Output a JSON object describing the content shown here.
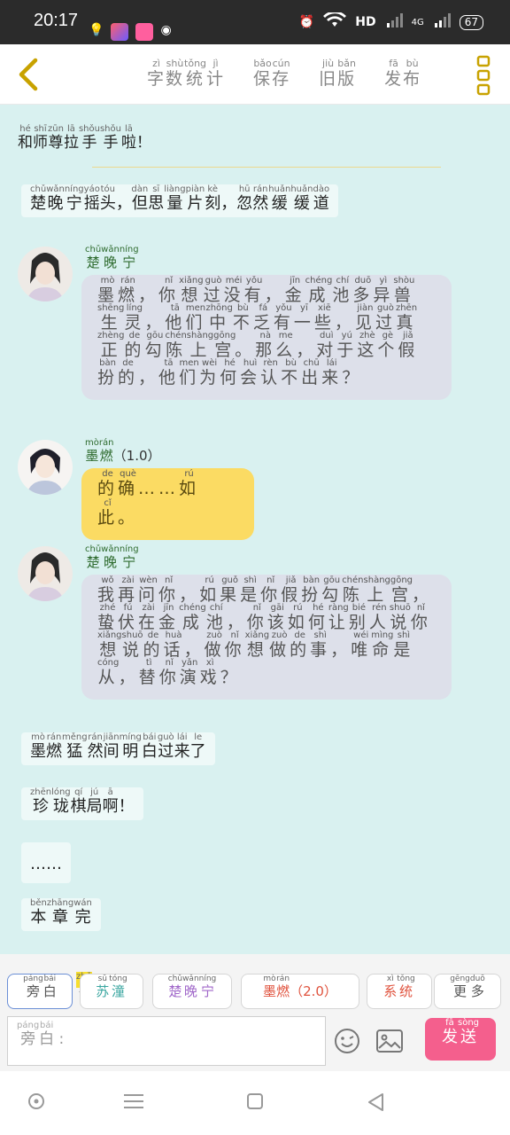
{
  "status": {
    "time": "20:17",
    "network": "HD",
    "signal_label": "4G",
    "battery": "67"
  },
  "header": {
    "actions": [
      {
        "text": "字数统计",
        "pinyin": [
          "zì",
          "shù",
          "tǒng",
          "jì"
        ]
      },
      {
        "text": "保存",
        "pinyin": [
          "bǎo",
          "cún"
        ]
      },
      {
        "text": "旧版",
        "pinyin": [
          "jiù",
          "bǎn"
        ]
      },
      {
        "text": "发布",
        "pinyin": [
          "fā",
          "bù"
        ]
      }
    ]
  },
  "messages": [
    {
      "kind": "narration",
      "text": "和师尊拉手手啦！",
      "pinyin": [
        "hé",
        "shī",
        "zūn",
        "lā",
        "shǒu",
        "shǒu",
        "lā",
        ""
      ]
    },
    {
      "kind": "narration",
      "text": "楚晚宁摇头，但思量片刻，忽然缓缓道",
      "pinyin": [
        "chǔ",
        "wǎn",
        "níng",
        "yáo",
        "tóu",
        "",
        "dàn",
        "sī",
        "liàng",
        "piàn",
        "kè",
        "",
        "hū",
        "rán",
        "huǎn",
        "huǎn",
        "dào"
      ]
    },
    {
      "kind": "bubble",
      "speaker": {
        "text": "楚晚宁",
        "pinyin": [
          "chǔ",
          "wǎn",
          "níng"
        ]
      },
      "text": "墨燃，你想过没有，金成池多异兽生灵，他们中不乏有一些，见过真正的勾陈上宫。那么，对于这个假扮的，他们为何会认不出来？",
      "pinyin": [
        "mò",
        "rán",
        "",
        "nǐ",
        "xiǎng",
        "guò",
        "méi",
        "yǒu",
        "",
        "jīn",
        "chéng",
        "chí",
        "duō",
        "yì",
        "shòu",
        "shēng",
        "líng",
        "",
        "tā",
        "men",
        "zhōng",
        "bù",
        "fá",
        "yǒu",
        "yī",
        "xiē",
        "",
        "jiàn",
        "guò",
        "zhēn",
        "zhèng",
        "de",
        "gōu",
        "chén",
        "shàng",
        "gōng",
        "",
        "nà",
        "me",
        "",
        "duì",
        "yú",
        "zhè",
        "gè",
        "jiǎ",
        "bàn",
        "de",
        "",
        "tā",
        "men",
        "wèi",
        "hé",
        "huì",
        "rèn",
        "bù",
        "chū",
        "lái",
        ""
      ]
    },
    {
      "kind": "bubble",
      "speaker": {
        "text": "墨燃",
        "pinyin": [
          "mò",
          "rán"
        ],
        "suffix": "（1.0）"
      },
      "text": "的确……如此。",
      "pinyin": [
        "de",
        "què",
        "",
        "",
        "rú",
        "cǐ",
        ""
      ]
    },
    {
      "kind": "bubble",
      "speaker": {
        "text": "楚晚宁",
        "pinyin": [
          "chǔ",
          "wǎn",
          "níng"
        ]
      },
      "text": "我再问你，如果是你假扮勾陈上宫，蛰伏在金成池，你该如何让别人说你想说的话，做你想做的事，唯命是从，替你演戏？",
      "pinyin": [
        "wǒ",
        "zài",
        "wèn",
        "nǐ",
        "",
        "rú",
        "guǒ",
        "shì",
        "nǐ",
        "jiǎ",
        "bàn",
        "gōu",
        "chén",
        "shàng",
        "gōng",
        "",
        "zhé",
        "fú",
        "zài",
        "jīn",
        "chéng",
        "chí",
        "",
        "nǐ",
        "gāi",
        "rú",
        "hé",
        "ràng",
        "bié",
        "rén",
        "shuō",
        "nǐ",
        "xiǎng",
        "shuō",
        "de",
        "huà",
        "",
        "zuò",
        "nǐ",
        "xiǎng",
        "zuò",
        "de",
        "shì",
        "",
        "wéi",
        "mìng",
        "shì",
        "cóng",
        "",
        "tì",
        "nǐ",
        "yǎn",
        "xì",
        ""
      ]
    },
    {
      "kind": "narration",
      "text": "墨燃猛然间明白过来了",
      "pinyin": [
        "mò",
        "rán",
        "měng",
        "rán",
        "jiān",
        "míng",
        "bái",
        "guò",
        "lái",
        "le"
      ]
    },
    {
      "kind": "narration",
      "text": "珍珑棋局啊！",
      "pinyin": [
        "zhēn",
        "lóng",
        "qí",
        "jú",
        "ā",
        ""
      ]
    },
    {
      "kind": "narration",
      "text": "……",
      "pinyin": [
        ""
      ]
    },
    {
      "kind": "narration",
      "text": "本章完",
      "pinyin": [
        "běn",
        "zhāng",
        "wán"
      ]
    }
  ],
  "roles": [
    {
      "text": "旁白",
      "pinyin": [
        "páng",
        "bái"
      ],
      "color": "#555555",
      "active": true
    },
    {
      "text": "苏潼",
      "pinyin": [
        "sū",
        "tóng"
      ],
      "color": "#3aa6a0",
      "badge": {
        "text": "主",
        "pinyin": "zhǔ"
      }
    },
    {
      "text": "楚晚宁",
      "pinyin": [
        "chǔ",
        "wǎn",
        "níng"
      ],
      "color": "#a067c9"
    },
    {
      "text": "墨燃",
      "pinyin": [
        "mò",
        "rán"
      ],
      "suffix": "（2.0）",
      "color": "#e0533e"
    },
    {
      "text": "系统",
      "pinyin": [
        "xì",
        "tǒng"
      ],
      "color": "#e0533e"
    },
    {
      "text": "更多",
      "pinyin": [
        "gēng",
        "duō"
      ],
      "color": "#555555"
    }
  ],
  "input": {
    "text": "旁白",
    "pinyin": [
      "páng",
      "bái"
    ],
    "colon": ":"
  },
  "send": {
    "text": "发送",
    "pinyin": [
      "fā",
      "sòng"
    ]
  }
}
